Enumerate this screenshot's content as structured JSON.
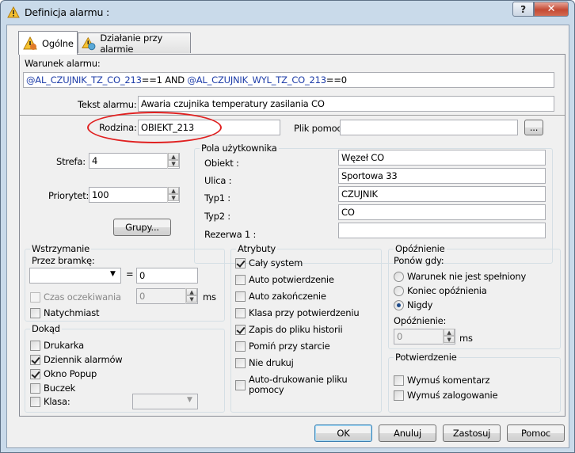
{
  "window": {
    "title": "Definicja alarmu :",
    "help_label": "?",
    "close_label": "✕"
  },
  "tabs": [
    {
      "label": "Ogólne"
    },
    {
      "label": "Działanie przy alarmie"
    }
  ],
  "warunek": {
    "label": "Warunek alarmu:",
    "part1": "@AL_CZUJNIK_TZ_CO_213",
    "part2": "==1 AND ",
    "part3": "@AL_CZUJNIK_WYL_TZ_CO_213",
    "part4": "==0"
  },
  "tekst": {
    "label": "Tekst alarmu:",
    "value": "Awaria czujnika temperatury zasilania CO"
  },
  "rodzina": {
    "label": "Rodzina:",
    "value": "OBIEKT_213"
  },
  "plik": {
    "label": "Plik pomocy:",
    "value": "",
    "browse": "..."
  },
  "strefa": {
    "label": "Strefa:",
    "value": "4"
  },
  "priorytet": {
    "label": "Priorytet:",
    "value": "100"
  },
  "grupy_button": "Grupy...",
  "pola": {
    "title": "Pola użytkownika",
    "rows": [
      {
        "label": "Obiekt :",
        "value": "Węzeł CO"
      },
      {
        "label": "Ulica :",
        "value": "Sportowa 33"
      },
      {
        "label": "Typ1 :",
        "value": "CZUJNIK"
      },
      {
        "label": "Typ2 :",
        "value": "CO"
      },
      {
        "label": "Rezerwa 1 :",
        "value": ""
      }
    ]
  },
  "wstrzymanie": {
    "title": "Wstrzymanie",
    "przez": "Przez bramkę:",
    "select": "",
    "eq": "=",
    "value": "0",
    "czas": "Czas oczekiwania",
    "czas_value": "0",
    "ms": "ms",
    "natychmiast": "Natychmiast"
  },
  "dokad": {
    "title": "Dokąd",
    "items": [
      {
        "label": "Drukarka",
        "checked": false
      },
      {
        "label": "Dziennik alarmów",
        "checked": true
      },
      {
        "label": "Okno Popup",
        "checked": true
      },
      {
        "label": "Buczek",
        "checked": false
      },
      {
        "label": "Klasa:",
        "checked": false
      }
    ],
    "klasa_select": ""
  },
  "atrybuty": {
    "title": "Atrybuty",
    "items": [
      {
        "label": "Cały system",
        "checked": true
      },
      {
        "label": "Auto potwierdzenie",
        "checked": false
      },
      {
        "label": "Auto zakończenie",
        "checked": false
      },
      {
        "label": "Klasa przy potwierdzeniu",
        "checked": false
      },
      {
        "label": "Zapis do pliku historii",
        "checked": true
      },
      {
        "label": "Pomiń przy starcie",
        "checked": false
      },
      {
        "label": "Nie drukuj",
        "checked": false
      },
      {
        "label": "Auto-drukowanie pliku",
        "label2": "pomocy",
        "checked": false
      }
    ]
  },
  "opoznienie": {
    "title": "Opóźnienie",
    "ponow": "Ponów gdy:",
    "options": [
      {
        "label": "Warunek nie jest spełniony",
        "selected": false
      },
      {
        "label": "Koniec opóźnienia",
        "selected": false
      },
      {
        "label": "Nigdy",
        "selected": true
      }
    ],
    "label": "Opóźnienie:",
    "value": "0",
    "ms": "ms"
  },
  "potwierdzenie": {
    "title": "Potwierdzenie",
    "items": [
      {
        "label": "Wymuś komentarz",
        "checked": false
      },
      {
        "label": "Wymuś zalogowanie",
        "checked": false
      }
    ]
  },
  "buttons": {
    "ok": "OK",
    "anuluj": "Anuluj",
    "zastosuj": "Zastosuj",
    "pomoc": "Pomoc"
  }
}
